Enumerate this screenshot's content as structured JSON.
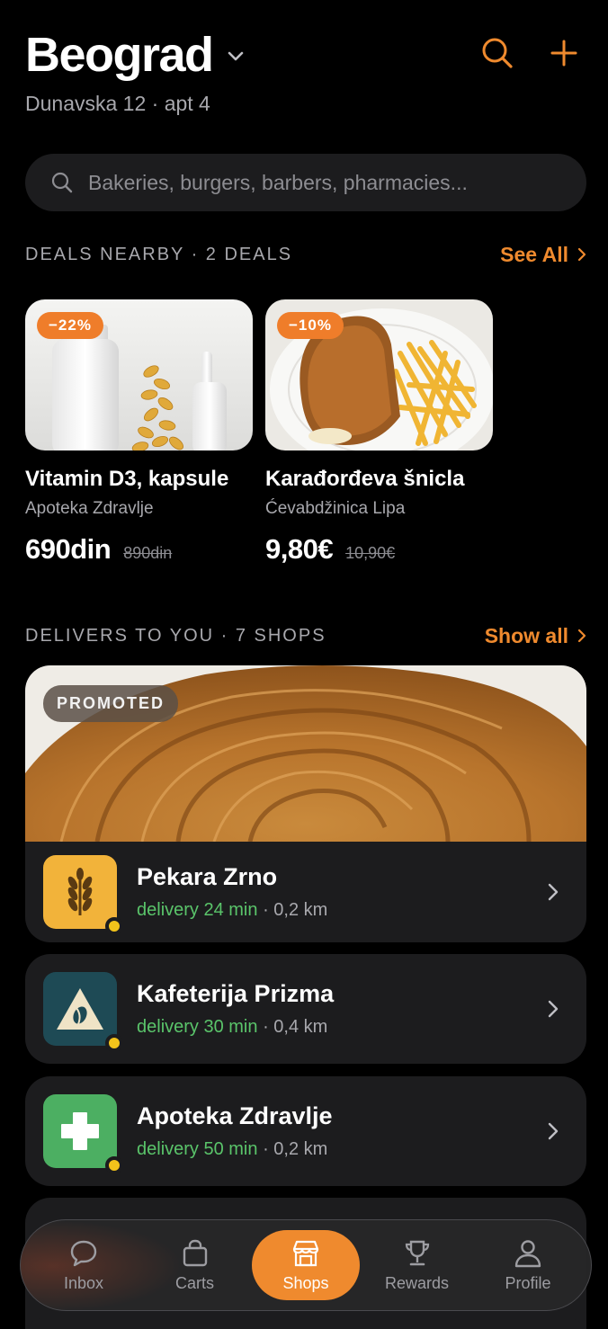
{
  "header": {
    "city": "Beograd",
    "address": "Dunavska 12 · apt 4"
  },
  "search": {
    "placeholder": "Bakeries, burgers, barbers, pharmacies..."
  },
  "deals_section": {
    "title": "DEALS NEARBY · 2 DEALS",
    "link": "See All"
  },
  "deals": [
    {
      "badge": "−22%",
      "name": "Vitamin D3, kapsule",
      "shop": "Apoteka Zdravlje",
      "price": "690din",
      "old_price": "890din"
    },
    {
      "badge": "−10%",
      "name": "Karađorđeva šnicla",
      "shop": "Ćevabdžinica Lipa",
      "price": "9,80€",
      "old_price": "10,90€"
    }
  ],
  "shops_section": {
    "title": "DELIVERS TO YOU · 7 SHOPS",
    "link": "Show all"
  },
  "promoted": {
    "badge": "PROMOTED",
    "name": "Pekara Zrno",
    "delivery": "delivery 24 min",
    "distance": "· 0,2 km"
  },
  "shops": [
    {
      "name": "Kafeterija Prizma",
      "delivery": "delivery 30 min",
      "distance": "· 0,4 km"
    },
    {
      "name": "Apoteka Zdravlje",
      "delivery": "delivery 50 min",
      "distance": "· 0,2 km"
    }
  ],
  "tabs": [
    {
      "label": "Inbox",
      "icon": "chat-bubble-icon"
    },
    {
      "label": "Carts",
      "icon": "shopping-bag-icon"
    },
    {
      "label": "Shops",
      "icon": "storefront-icon"
    },
    {
      "label": "Rewards",
      "icon": "trophy-icon"
    },
    {
      "label": "Profile",
      "icon": "person-icon"
    }
  ],
  "colors": {
    "accent": "#ef8a2e",
    "delivery_green": "#5ac46a",
    "status_dot": "#f2c31b",
    "card_bg": "#1c1c1e"
  }
}
